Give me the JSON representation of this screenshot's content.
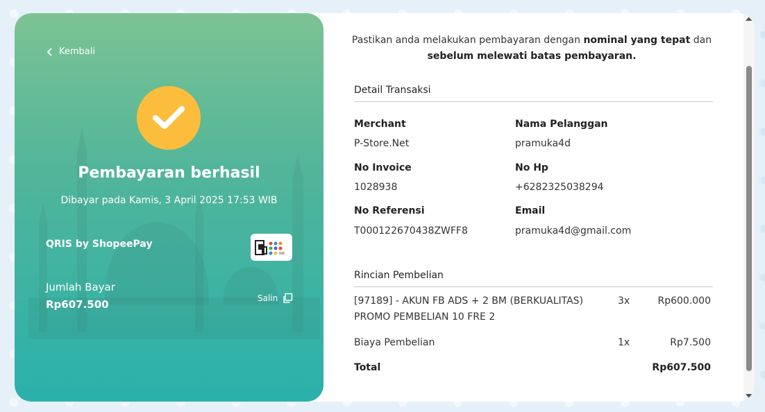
{
  "left": {
    "back_label": "Kembali",
    "title": "Pembayaran berhasil",
    "paid_at": "Dibayar pada Kamis, 3 April 2025 17:53 WIB",
    "method": "QRIS by ShopeePay",
    "amount_label": "Jumlah Bayar",
    "amount_value": "Rp607.500",
    "copy_label": "Salin"
  },
  "notice": {
    "part1": "Pastikan anda melakukan pembayaran dengan ",
    "bold1": "nominal yang tepat",
    "part2": " dan ",
    "bold2": "sebelum melewati batas pembayaran."
  },
  "transaction": {
    "section_title": "Detail Transaksi",
    "merchant_label": "Merchant",
    "merchant_value": "P-Store.Net",
    "customer_label": "Nama Pelanggan",
    "customer_value": "pramuka4d",
    "invoice_label": "No Invoice",
    "invoice_value": "1028938",
    "phone_label": "No Hp",
    "phone_value": "+6282325038294",
    "reference_label": "No Referensi",
    "reference_value": "T000122670438ZWFF8",
    "email_label": "Email",
    "email_value": "pramuka4d@gmail.com"
  },
  "purchase": {
    "section_title": "Rincian Pembelian",
    "items": [
      {
        "desc_line1": "[97189] - AKUN FB ADS + 2 BM (BERKUALITAS)",
        "desc_line2": "PROMO PEMBELIAN 10 FRE 2",
        "qty": "3x",
        "price": "Rp600.000"
      },
      {
        "desc_line1": "Biaya Pembelian",
        "desc_line2": "",
        "qty": "1x",
        "price": "Rp7.500"
      }
    ],
    "total_label": "Total",
    "total_value": "Rp607.500"
  },
  "colors": {
    "accent_yellow": "#fcbd3c",
    "gradient_top": "#7cc393",
    "gradient_bottom": "#2ab1ab"
  }
}
